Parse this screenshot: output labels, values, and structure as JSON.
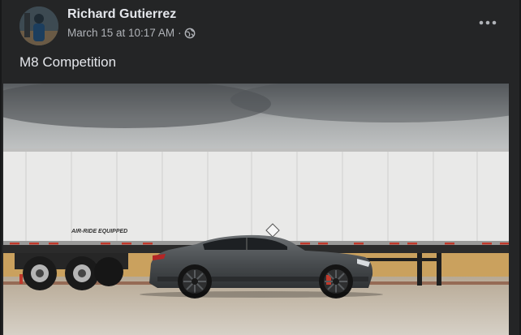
{
  "post": {
    "author": "Richard Gutierrez",
    "timestamp": "March 15 at 10:17 AM",
    "separator": "·",
    "privacy_icon": "globe-icon",
    "more_icon": "more-horizontal-icon",
    "caption": "M8 Competition"
  },
  "photo": {
    "trailer_text": "AIR-RIDE EQUIPPED",
    "description": "Grey BMW M8 Competition parked in front of a white semi-trailer"
  },
  "colors": {
    "background": "#18191a",
    "card": "#242526",
    "primary_text": "#e4e6eb",
    "secondary_text": "#b0b3b8"
  }
}
